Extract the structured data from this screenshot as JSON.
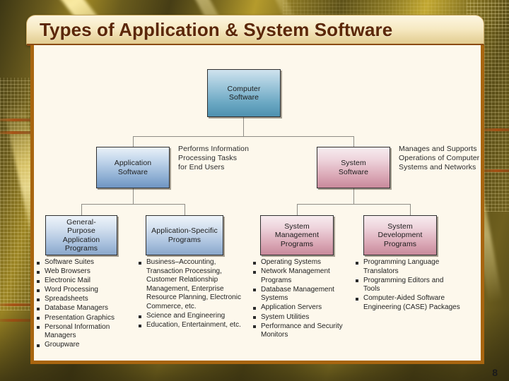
{
  "slide": {
    "title": "Types of Application & System Software",
    "page_number": "8",
    "colors": {
      "title_text": "#5b2708",
      "title_bar_bg": "#f6e9c2",
      "panel_bg": "#fdf8ec",
      "panel_border": "#a8650f",
      "background": "#8a7724",
      "node_blue_deep": "#6aa7c2",
      "node_blue": "#93b3d6",
      "node_pink": "#dba9b7",
      "connector": "#8f8d86"
    }
  },
  "diagram": {
    "type": "hierarchy",
    "root": {
      "id": "computer-software",
      "label_line1": "Computer",
      "label_line2": "Software",
      "style": "blue-deep"
    },
    "level2": [
      {
        "id": "application-software",
        "label_line1": "Application",
        "label_line2": "Software",
        "style": "blue",
        "annotation": [
          "Performs Information",
          "Processing Tasks",
          "for End Users"
        ]
      },
      {
        "id": "system-software",
        "label_line1": "System",
        "label_line2": "Software",
        "style": "pink",
        "annotation": [
          "Manages and Supports",
          "Operations of Computer",
          "Systems and Networks"
        ]
      }
    ],
    "level3": [
      {
        "id": "general-purpose-application-programs",
        "label_line1": "General-",
        "label_line2": "Purpose",
        "label_line3": "Application",
        "label_line4": "Programs",
        "style": "blue-soft"
      },
      {
        "id": "application-specific-programs",
        "label_line1": "Application-Specific",
        "label_line2": "Programs",
        "label_line3": "",
        "label_line4": "",
        "style": "blue-soft"
      },
      {
        "id": "system-management-programs",
        "label_line1": "System",
        "label_line2": "Management",
        "label_line3": "Programs",
        "label_line4": "",
        "style": "pink"
      },
      {
        "id": "system-development-programs",
        "label_line1": "System",
        "label_line2": "Development",
        "label_line3": "Programs",
        "label_line4": "",
        "style": "pink"
      }
    ]
  },
  "lists": {
    "general_purpose": [
      "Software Suites",
      "Web Browsers",
      "Electronic Mail",
      "Word Processing",
      "Spreadsheets",
      "Database Managers",
      "Presentation Graphics",
      "Personal Information Managers",
      "Groupware"
    ],
    "application_specific": [
      "Business–Accounting, Transaction Processing, Customer Relationship Management, Enterprise Resource Planning, Electronic Commerce, etc.",
      "Science and Engineering",
      "Education, Entertainment, etc."
    ],
    "system_management": [
      "Operating Systems",
      "Network Management Programs",
      "Database Management Systems",
      "Application Servers",
      "System Utilities",
      "Performance and Security Monitors"
    ],
    "system_development": [
      "Programming Language Translators",
      "Programming Editors and Tools",
      "Computer-Aided Software Engineering (CASE) Packages"
    ]
  }
}
